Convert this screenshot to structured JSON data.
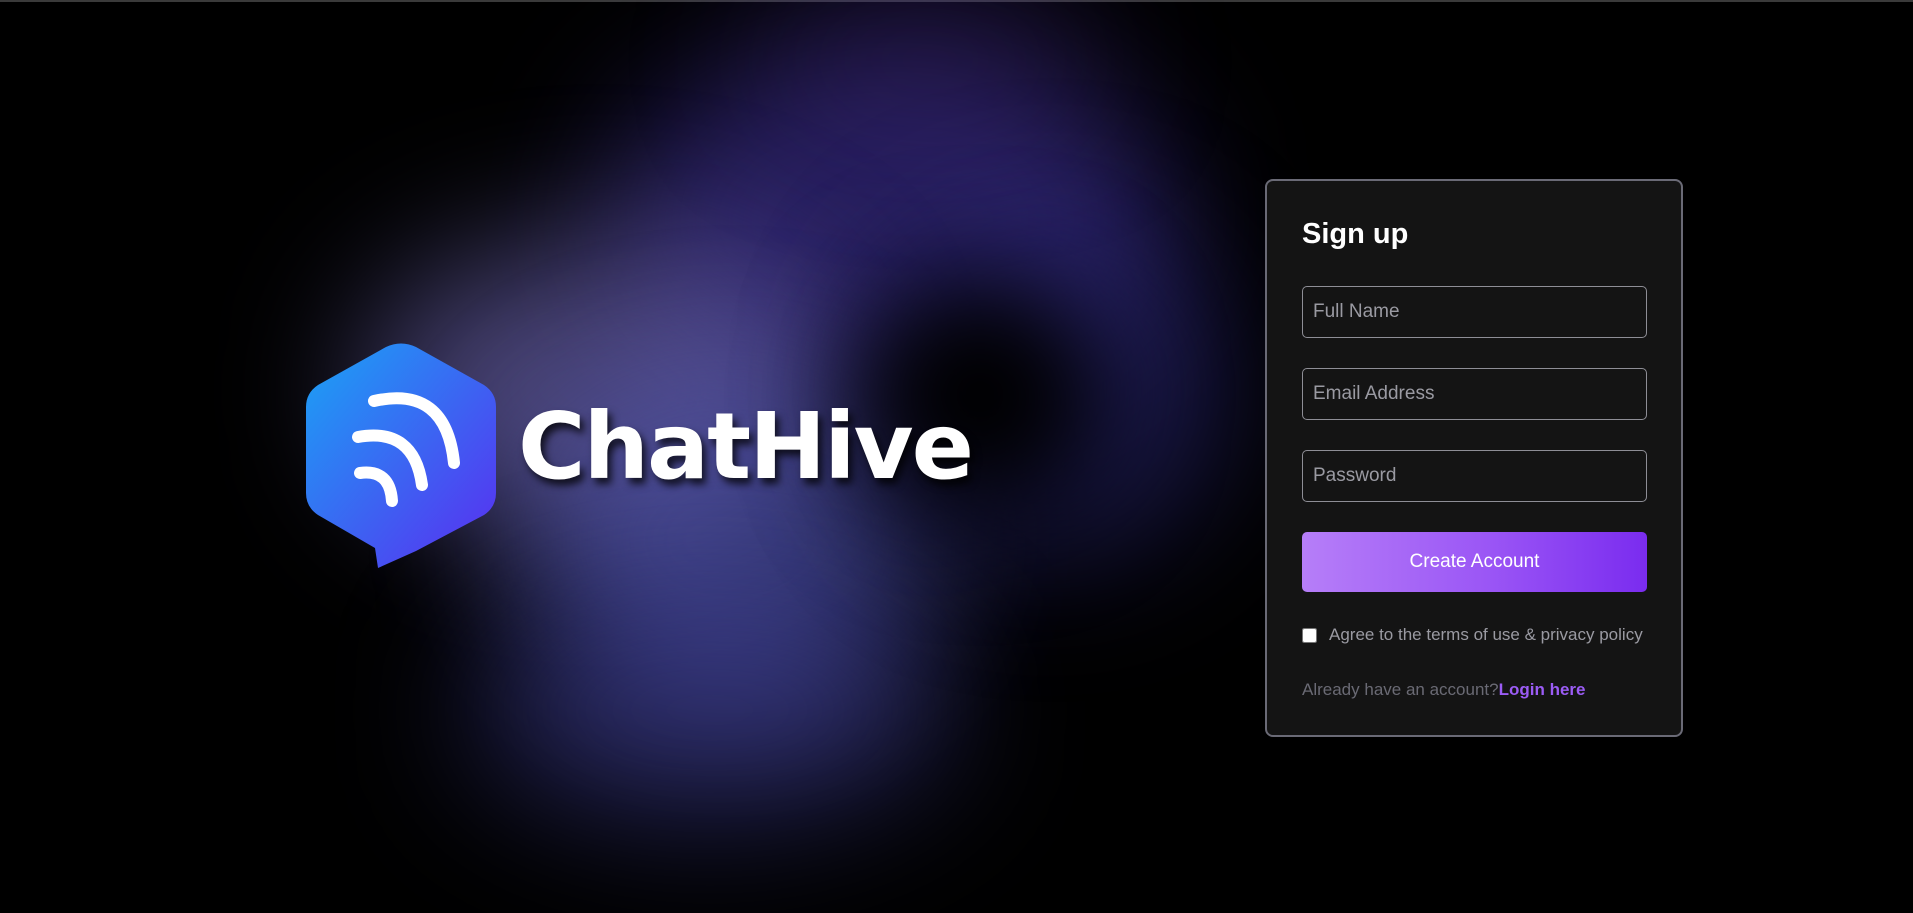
{
  "brand": {
    "name": "ChatHive",
    "logo_icon": "chat-signal-hexagon-icon"
  },
  "signup": {
    "title": "Sign up",
    "full_name_placeholder": "Full Name",
    "full_name_value": "",
    "email_placeholder": "Email Address",
    "email_value": "",
    "password_placeholder": "Password",
    "password_value": "",
    "create_button_label": "Create Account",
    "terms_checked": false,
    "terms_label": "Agree to the terms of use & privacy policy",
    "login_prompt": "Already have an account?",
    "login_link_label": "Login here"
  },
  "colors": {
    "background": "#000000",
    "card_background": "#141414",
    "accent": "#9b5cf5",
    "button_gradient_start": "#b67ef8",
    "button_gradient_end": "#7a2cef",
    "logo_gradient_start": "#1aa3f5",
    "logo_gradient_end": "#5a2cf0"
  }
}
